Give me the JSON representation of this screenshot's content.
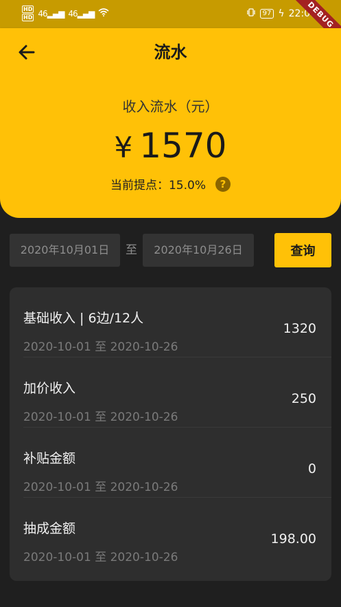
{
  "status_bar": {
    "hd1": "HD",
    "hd2": "HD",
    "signal1": "46",
    "signal2": "46",
    "battery": "97",
    "time": "22:00",
    "debug": "DEBUG"
  },
  "app_bar": {
    "title": "流水",
    "back_icon": "arrow-left-icon"
  },
  "summary": {
    "label": "收入流水（元）",
    "currency": "¥",
    "amount": "1570",
    "rate_label": "当前提点：15.0%",
    "help_icon": "?"
  },
  "filter": {
    "start_date": "2020年10月01日",
    "separator": "至",
    "end_date": "2020年10月26日",
    "query_label": "查询"
  },
  "items": [
    {
      "title": "基础收入 | 6边/12人",
      "date_range": "2020-10-01 至 2020-10-26",
      "value": "1320"
    },
    {
      "title": "加价收入",
      "date_range": "2020-10-01 至 2020-10-26",
      "value": "250"
    },
    {
      "title": "补贴金额",
      "date_range": "2020-10-01 至 2020-10-26",
      "value": "0"
    },
    {
      "title": "抽成金额",
      "date_range": "2020-10-01 至 2020-10-26",
      "value": "198.00"
    }
  ],
  "colors": {
    "accent": "#ffc107",
    "background": "#1f1f1f",
    "card": "#2e2e2e"
  }
}
